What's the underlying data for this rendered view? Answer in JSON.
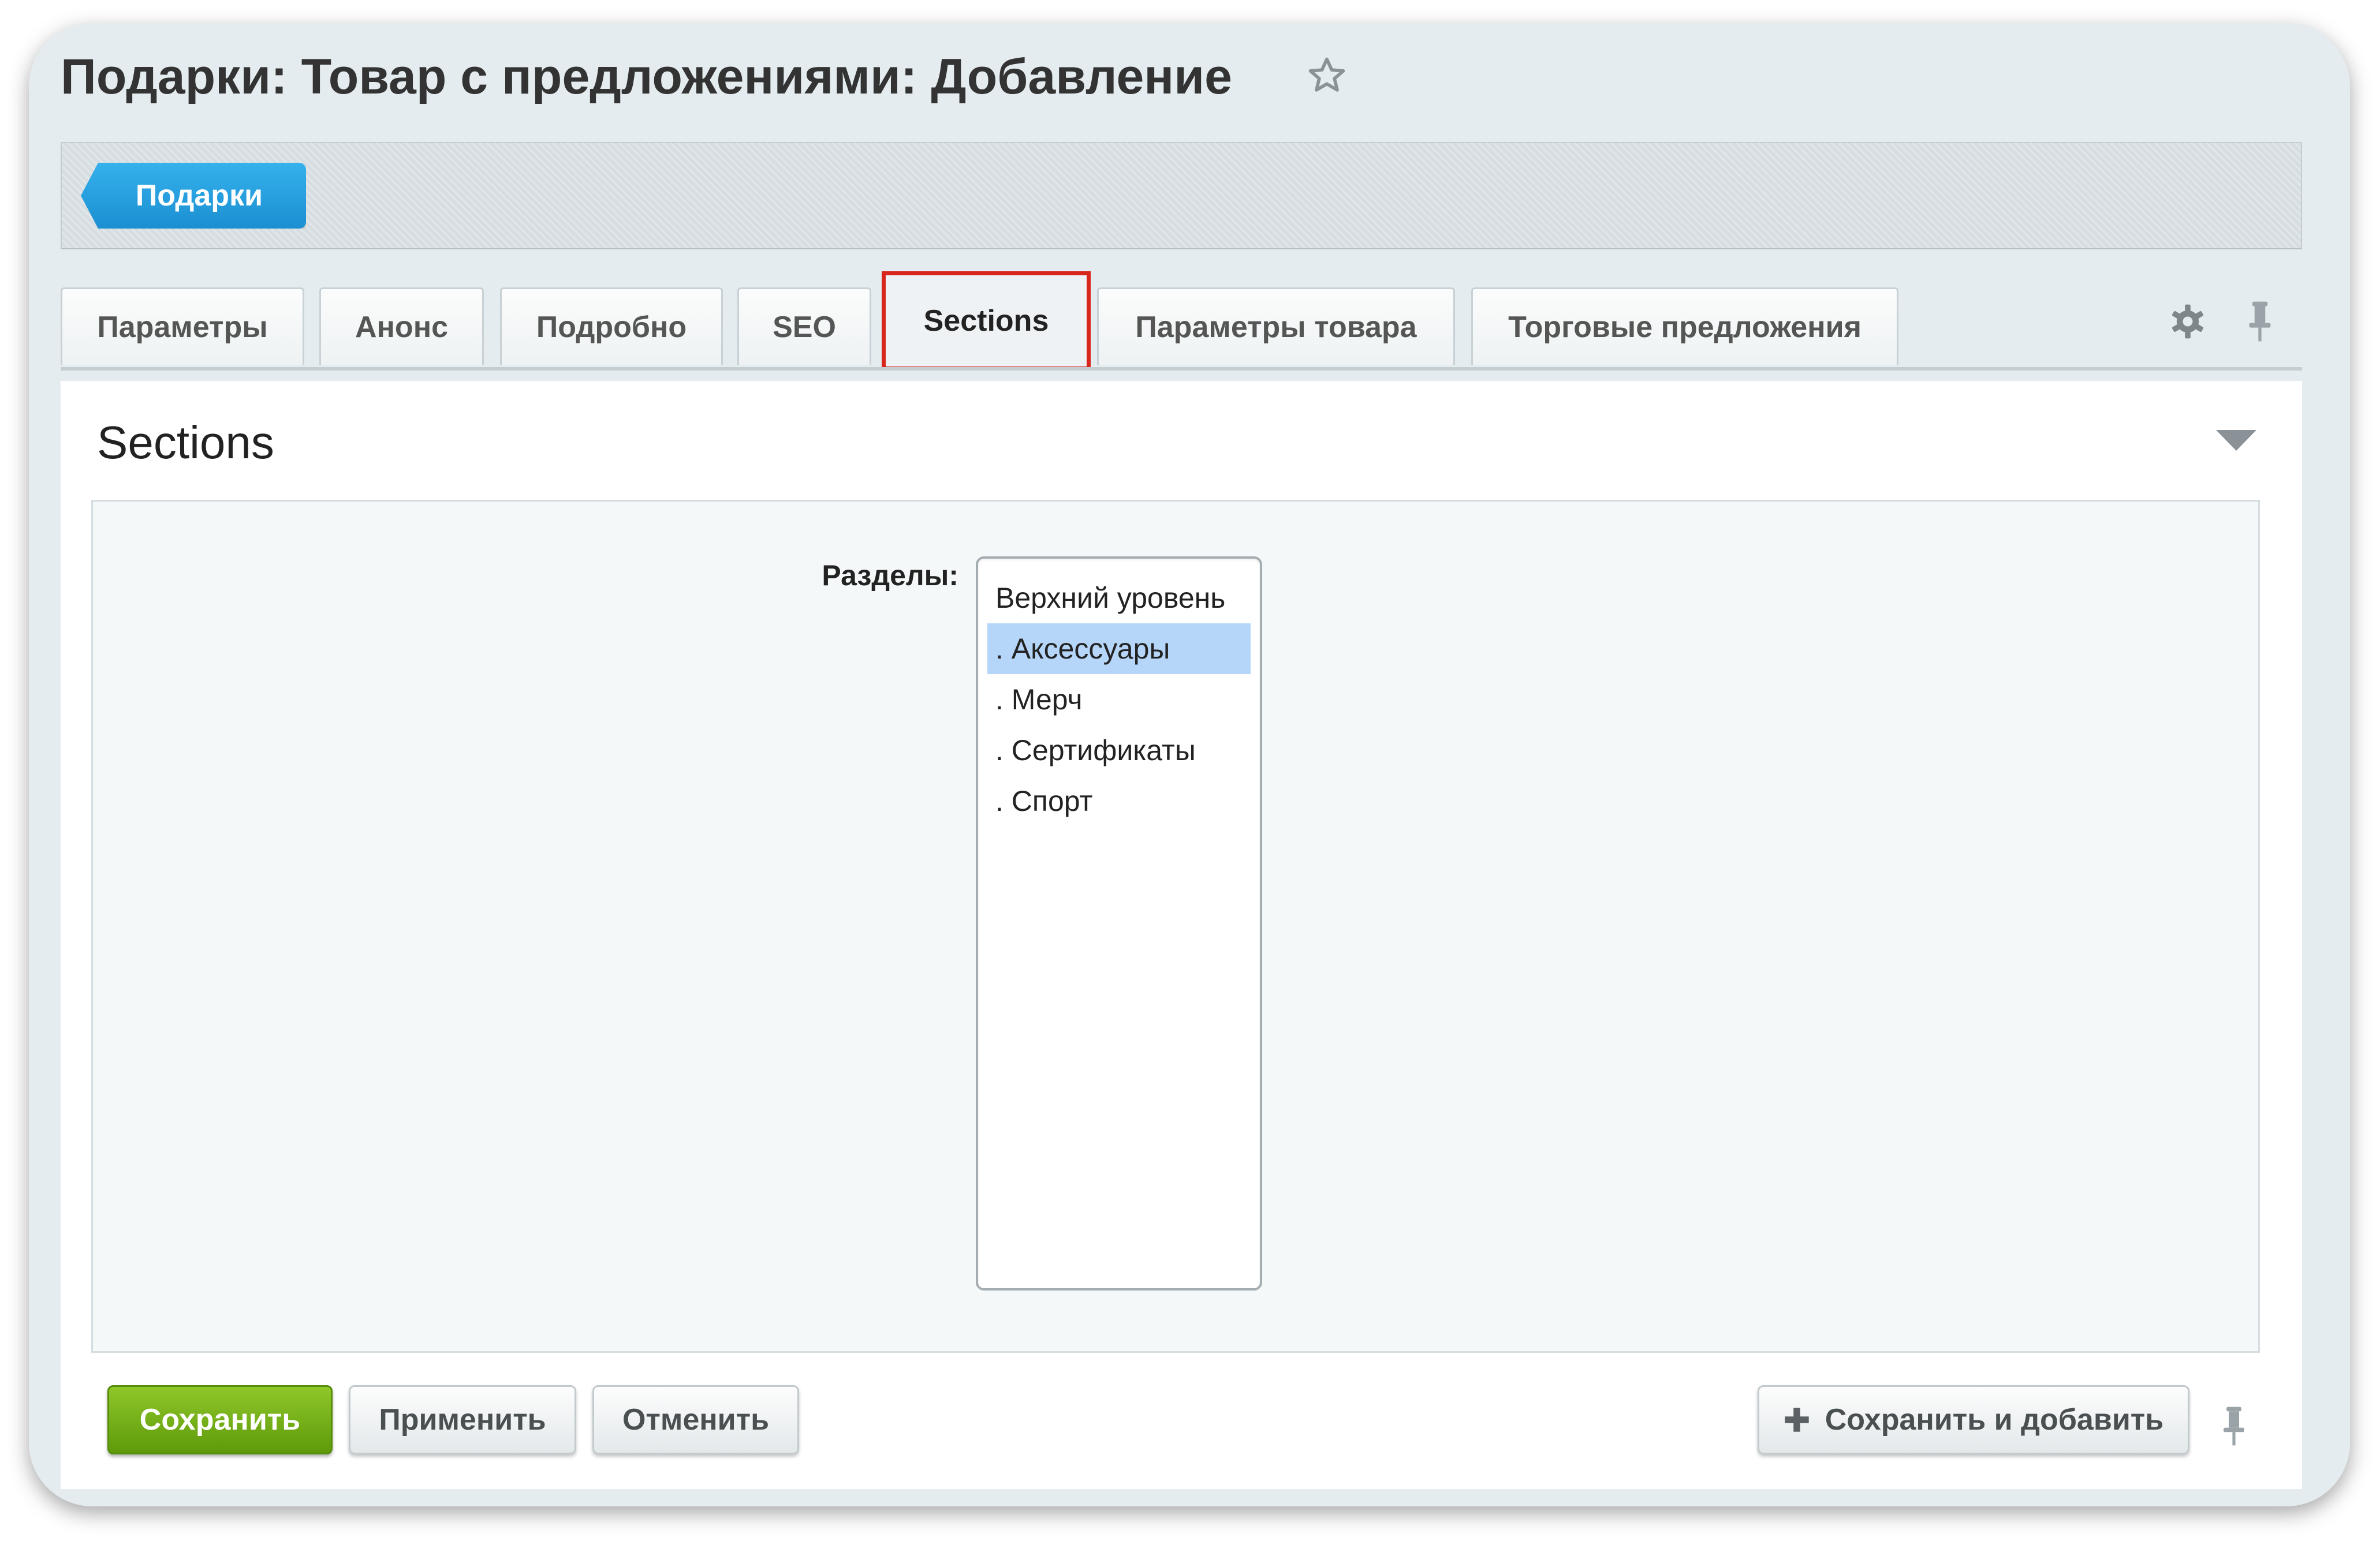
{
  "page": {
    "title": "Подарки: Товар с предложениями: Добавление",
    "favorite_icon": "star-icon"
  },
  "nav": {
    "chip_label": "Подарки"
  },
  "tabs": [
    {
      "label": "Параметры",
      "active": false
    },
    {
      "label": "Анонс",
      "active": false
    },
    {
      "label": "Подробно",
      "active": false
    },
    {
      "label": "SEO",
      "active": false
    },
    {
      "label": "Sections",
      "active": true
    },
    {
      "label": "Параметры товара",
      "active": false
    },
    {
      "label": "Торговые предложения",
      "active": false
    }
  ],
  "tab_tools": {
    "settings_icon": "gear-icon",
    "pin_icon": "pin-icon"
  },
  "section": {
    "title": "Sections",
    "collapse_icon": "triangle-down-icon"
  },
  "form": {
    "sections_label": "Разделы:",
    "sections_options": [
      {
        "label": "Верхний уровень",
        "selected": false
      },
      {
        "label": ". Аксессуары",
        "selected": true
      },
      {
        "label": ". Мерч",
        "selected": false
      },
      {
        "label": ". Сертификаты",
        "selected": false
      },
      {
        "label": ". Спорт",
        "selected": false
      }
    ]
  },
  "footer": {
    "save_label": "Сохранить",
    "apply_label": "Применить",
    "cancel_label": "Отменить",
    "save_add_label": "Сохранить и добавить",
    "save_add_icon": "plus-icon",
    "pin_icon": "pin-icon"
  },
  "colors": {
    "accent_blue": "#1b8fd2",
    "save_green": "#6aab12",
    "active_tab_highlight": "#d9261c",
    "selected_option": "#b6d6f9"
  }
}
